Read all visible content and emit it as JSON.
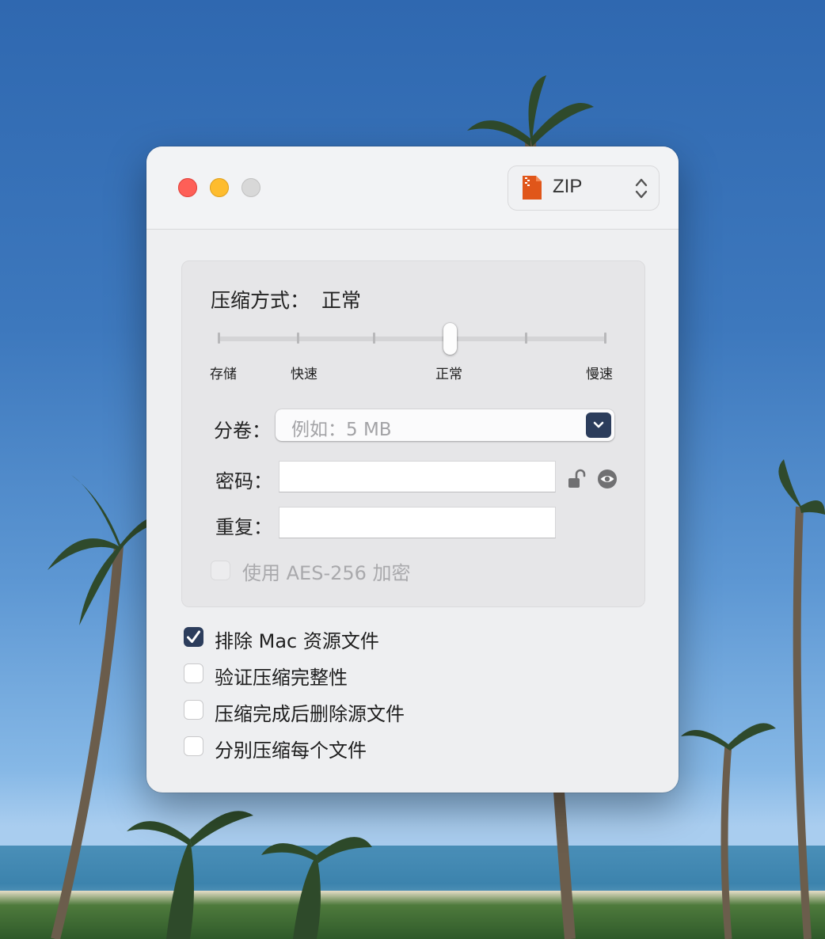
{
  "window": {
    "format_select": {
      "value": "ZIP",
      "icon": "zip-file-icon"
    }
  },
  "compression": {
    "method_label": "压缩方式：",
    "method_value": "正常",
    "slider_labels": [
      "存储",
      "快速",
      "正常",
      "慢速"
    ],
    "slider_level": 0.6
  },
  "split": {
    "label": "分卷：",
    "placeholder": "例如：5 MB"
  },
  "password": {
    "label": "密码：",
    "value": ""
  },
  "repeat": {
    "label": "重复：",
    "value": ""
  },
  "aes": {
    "label": "使用 AES-256 加密",
    "checked": false,
    "enabled": false
  },
  "options": [
    {
      "label": "排除 Mac 资源文件",
      "checked": true
    },
    {
      "label": "验证压缩完整性",
      "checked": false
    },
    {
      "label": "压缩完成后删除源文件",
      "checked": false
    },
    {
      "label": "分别压缩每个文件",
      "checked": false
    }
  ],
  "colors": {
    "accent": "#2c3d5c",
    "close": "#fe5f57",
    "minimize": "#febc2e",
    "zoom": "#d8d8d8"
  }
}
